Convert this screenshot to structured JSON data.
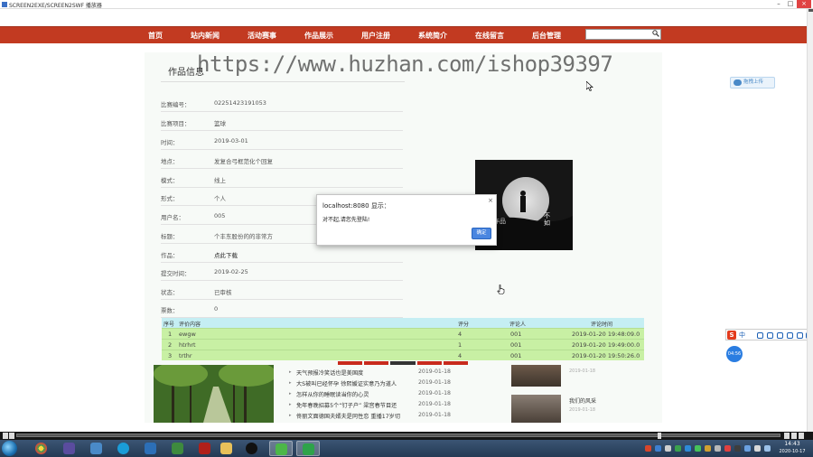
{
  "window": {
    "title": "SCREEN2EXE/SCREEN2SWF 播放器"
  },
  "nav": {
    "items": [
      "首页",
      "站内新闻",
      "活动赛事",
      "作品展示",
      "用户注册",
      "系统简介",
      "在线留言",
      "后台管理"
    ],
    "search": {
      "value": ""
    }
  },
  "section": {
    "title": "作品信息"
  },
  "details": [
    {
      "label": "比赛编号：",
      "value": "02251423191053"
    },
    {
      "label": "比赛项目：",
      "value": "篮球"
    },
    {
      "label": "时间：",
      "value": "2019-03-01"
    },
    {
      "label": "地点：",
      "value": "发复合弓框范化个回复"
    },
    {
      "label": "模式：",
      "value": "线上"
    },
    {
      "label": "形式：",
      "value": "个人"
    },
    {
      "label": "用户名：",
      "value": "005"
    },
    {
      "label": "标题：",
      "value": "个丰东股份的的非常方"
    },
    {
      "label": "作品：",
      "value": "点此下载"
    },
    {
      "label": "提交时间：",
      "value": "2019-02-25"
    },
    {
      "label": "状态：",
      "value": "已审核"
    },
    {
      "label": "票数：",
      "value": "0"
    }
  ],
  "dialog": {
    "title": "localhost:8080 显示：",
    "message": "对不起,请您先登陆!",
    "ok_label": "确定",
    "close_label": "×"
  },
  "comments": {
    "headers": [
      "序号",
      "评价内容",
      "评分",
      "评论人",
      "评论时间"
    ],
    "rows": [
      [
        "1",
        "ewgw",
        "4",
        "001",
        "2019-01-20 19:48:09.0"
      ],
      [
        "2",
        "htrhrt",
        "1",
        "001",
        "2019-01-20 19:49:00.0"
      ],
      [
        "3",
        "trthr",
        "4",
        "001",
        "2019-01-20 19:50:26.0"
      ]
    ]
  },
  "news": [
    {
      "title": "天气预报冷笑话也是美国度",
      "date": "2019-01-18"
    },
    {
      "title": "大S被叫已经怀孕 徐熙媛证实意乃为道人",
      "date": "2019-01-18"
    },
    {
      "title": "怎样从你的睡眠读当你的心灵",
      "date": "2019-01-18"
    },
    {
      "title": "免年春晚招募5个“钉子户” 梁宫春节目还",
      "date": "2019-01-18"
    },
    {
      "title": "佟丽文面德国夫婿夫是同性恋 重播17岁切",
      "date": "2019-01-18"
    }
  ],
  "side": {
    "date1": "2019-01-18",
    "caption": "我们的风采",
    "date2": "2019-01-18"
  },
  "watermark": "https://www.huzhan.com/ishop39397",
  "widgets": {
    "upload_label": "拖拽上传",
    "ime_label": "中",
    "speed": "04:56"
  },
  "taskbar": {
    "time": "14:43",
    "date": "2020-10-17"
  }
}
